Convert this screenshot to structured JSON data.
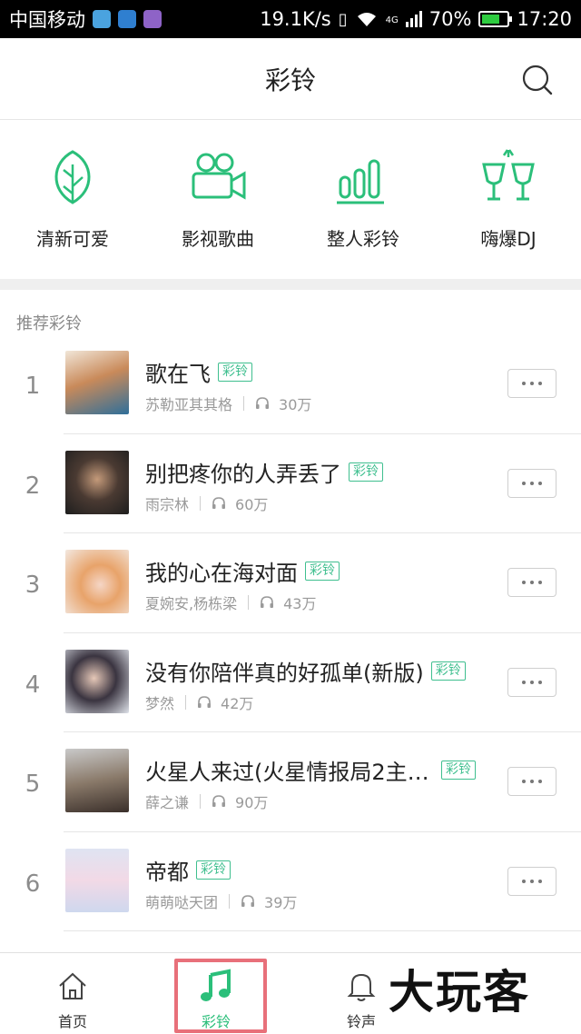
{
  "status_bar": {
    "carrier": "中国移动",
    "speed": "19.1K/s",
    "network": "4G",
    "battery": "70%",
    "battery_level": 0.7,
    "time": "17:20"
  },
  "header": {
    "title": "彩铃",
    "search_icon": "search-icon"
  },
  "categories": [
    {
      "label": "清新可爱",
      "icon": "leaf-icon"
    },
    {
      "label": "影视歌曲",
      "icon": "video-camera-icon"
    },
    {
      "label": "整人彩铃",
      "icon": "bars-icon"
    },
    {
      "label": "嗨爆DJ",
      "icon": "cheers-icon"
    }
  ],
  "section_title": "推荐彩铃",
  "badge_label": "彩铃",
  "songs": [
    {
      "rank": "1",
      "title": "歌在飞",
      "artist": "苏勒亚其其格",
      "plays": "30万"
    },
    {
      "rank": "2",
      "title": "别把疼你的人弄丢了",
      "artist": "雨宗林",
      "plays": "60万"
    },
    {
      "rank": "3",
      "title": "我的心在海对面",
      "artist": "夏婉安,杨栋梁",
      "plays": "43万"
    },
    {
      "rank": "4",
      "title": "没有你陪伴真的好孤单(新版)",
      "artist": "梦然",
      "plays": "42万"
    },
    {
      "rank": "5",
      "title": "火星人来过(火星情报局2主…",
      "artist": "薛之谦",
      "plays": "90万"
    },
    {
      "rank": "6",
      "title": "帝都",
      "artist": "萌萌哒天团",
      "plays": "39万"
    }
  ],
  "bottom_nav": {
    "home": "首页",
    "ringtone": "彩铃",
    "bell": "铃声"
  },
  "watermark": "大玩客",
  "colors": {
    "accent": "#2bbf7a",
    "highlight": "#e8707a"
  }
}
